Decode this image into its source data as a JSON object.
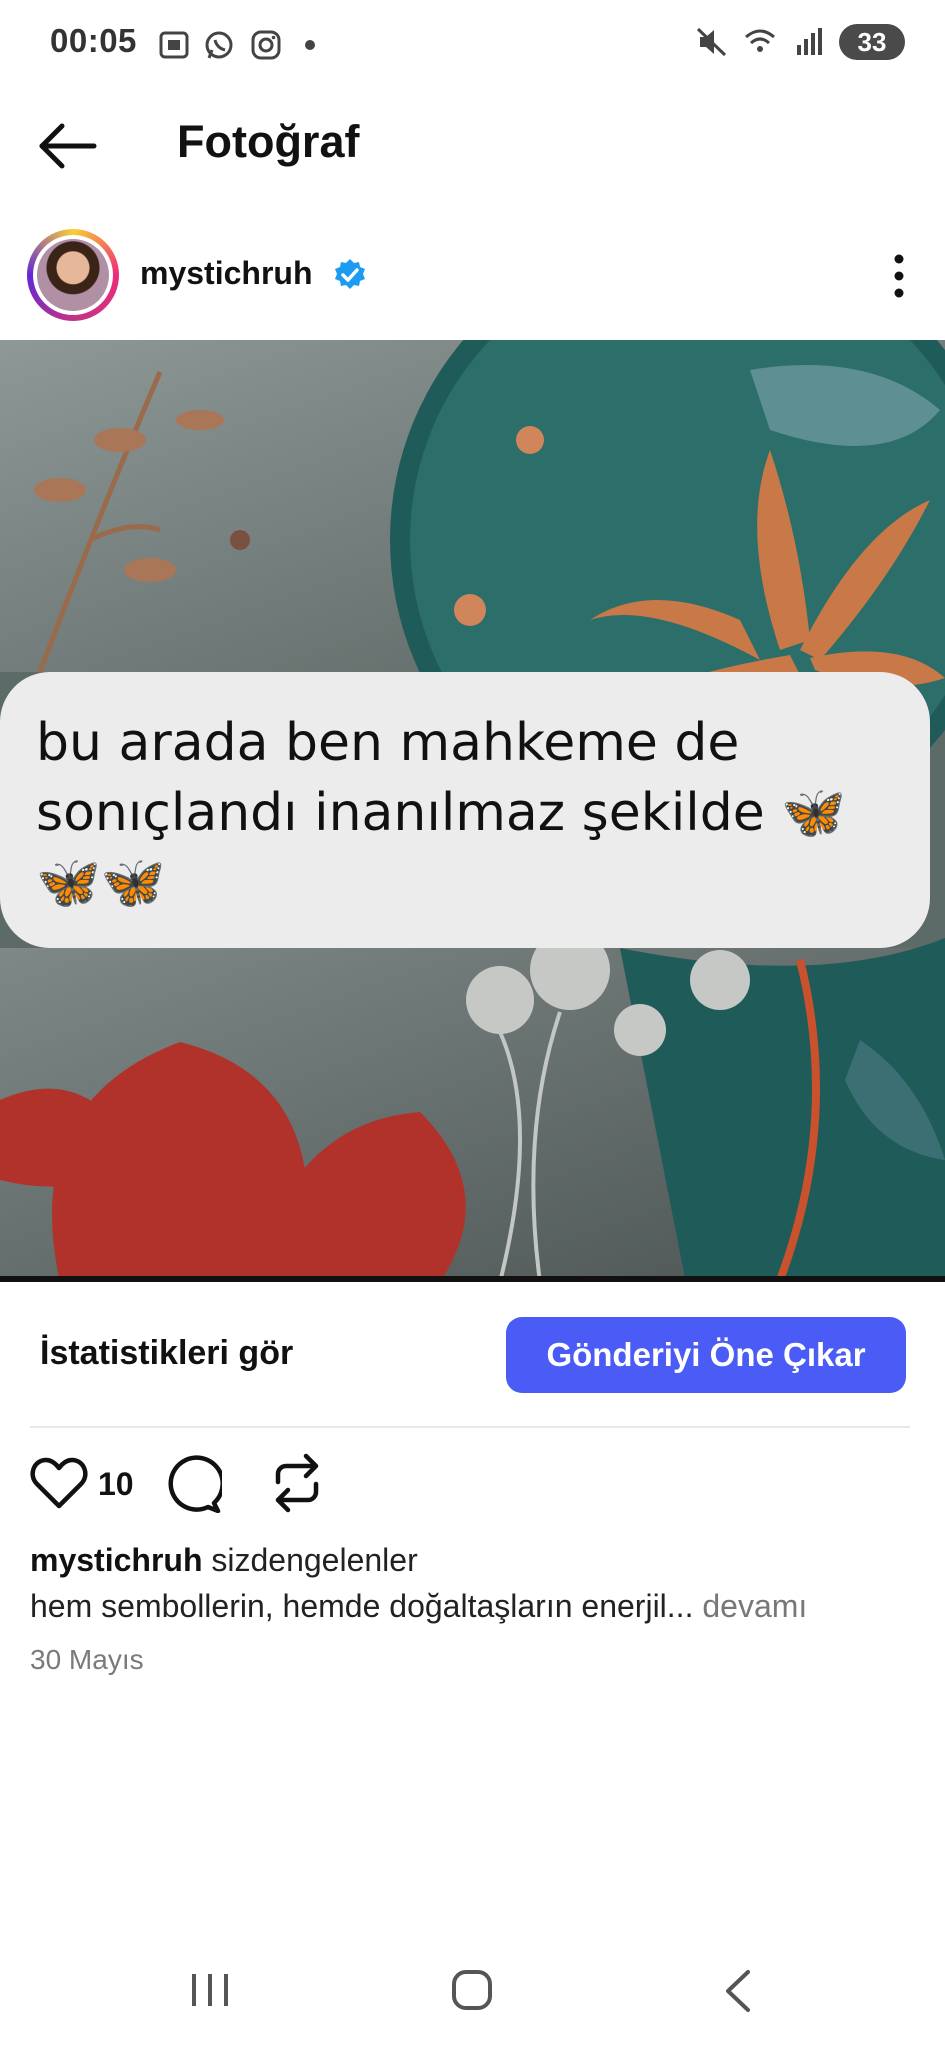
{
  "status_bar": {
    "time": "00:05",
    "battery": "33",
    "icons": [
      "screenshot-icon",
      "whatsapp-icon",
      "instagram-icon",
      "dot-icon",
      "mute-icon",
      "wifi-icon",
      "signal-icon",
      "battery-icon"
    ]
  },
  "header": {
    "title": "Fotoğraf",
    "back_icon": "arrow-left-icon"
  },
  "post": {
    "username": "mystichruh",
    "verified_icon": "verified-badge-icon",
    "more_icon": "more-vertical-icon",
    "image_text": "bu arada ben mahkeme de sonıçlandı inanılmaz şekilde 🦋🦋🦋",
    "stats_label": "İstatistikleri gör",
    "boost_label": "Gönderiyi Öne Çıkar",
    "like_count": "10",
    "caption_user": "mystichruh",
    "caption_text": "sizdengelenler",
    "caption_line2": "hem sembollerin, hemde doğaltaşların enerjil...",
    "more_label": "devamı",
    "date": "30 Mayıs"
  },
  "colors": {
    "accent": "#4a5cf5",
    "verified": "#1d9bf0",
    "bubble": "#ececed"
  }
}
